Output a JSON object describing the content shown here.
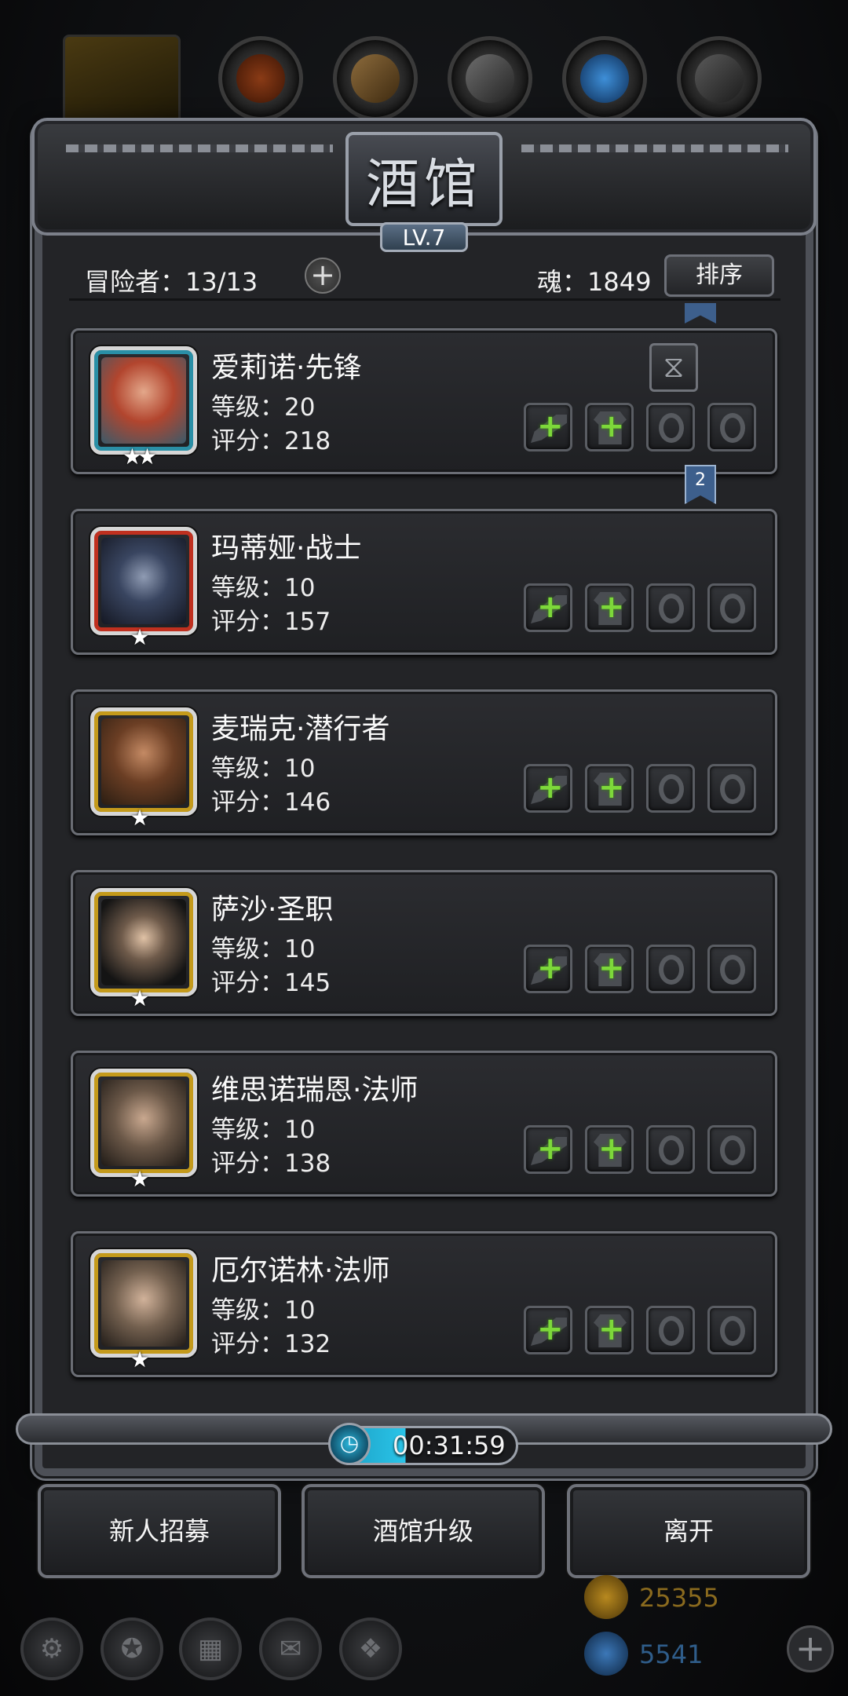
{
  "panel": {
    "title": "酒馆",
    "level": "LV.7"
  },
  "info": {
    "adventurers": "冒险者：13/13",
    "soul": "魂：1849",
    "sort_label": "排序"
  },
  "heroes": [
    {
      "name": "爱莉诺·先锋",
      "level": "等级：20",
      "score": "评分：218",
      "stars": "★★",
      "frame_color": "#2a8fa6"
    },
    {
      "name": "玛蒂娅·战士",
      "level": "等级：10",
      "score": "评分：157",
      "stars": "★",
      "frame_color": "#c0301f"
    },
    {
      "name": "麦瑞克·潜行者",
      "level": "等级：10",
      "score": "评分：146",
      "stars": "★",
      "frame_color": "#c49a1b"
    },
    {
      "name": "萨沙·圣职",
      "level": "等级：10",
      "score": "评分：145",
      "stars": "★",
      "frame_color": "#c49a1b"
    },
    {
      "name": "维思诺瑞恩·法师",
      "level": "等级：10",
      "score": "评分：138",
      "stars": "★",
      "frame_color": "#c49a1b"
    },
    {
      "name": "厄尔诺林·法师",
      "level": "等级：10",
      "score": "评分：132",
      "stars": "★",
      "frame_color": "#c49a1b"
    }
  ],
  "ribbon_label": "2",
  "timer": "00:31:59",
  "actions": {
    "recruit": "新人招募",
    "upgrade": "酒馆升级",
    "leave": "离开"
  },
  "currency": {
    "gold": "25355",
    "gems": "5541"
  },
  "colors": {
    "gold_text": "#8a6a1e",
    "gem_text": "#2f5d8a",
    "equip_plus": "#7dd83a"
  }
}
